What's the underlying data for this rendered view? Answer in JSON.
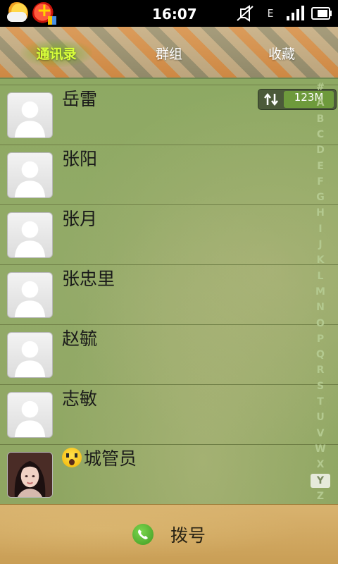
{
  "status_bar": {
    "time": "16:07",
    "network_type": "E",
    "icons": [
      "weather-icon",
      "app-notification-icon",
      "mute-icon",
      "network-type-icon",
      "signal-icon",
      "battery-icon"
    ]
  },
  "tabs": [
    {
      "label": "通讯录",
      "active": true
    },
    {
      "label": "群组",
      "active": false
    },
    {
      "label": "收藏",
      "active": false
    }
  ],
  "memory_badge": {
    "value": "123M",
    "icon": "swap-arrows-icon"
  },
  "contacts": [
    {
      "name": "岳雷",
      "avatar": "default-avatar"
    },
    {
      "name": "张阳",
      "avatar": "default-avatar"
    },
    {
      "name": "张月",
      "avatar": "default-avatar"
    },
    {
      "name": "张忠里",
      "avatar": "default-avatar"
    },
    {
      "name": "赵毓",
      "avatar": "default-avatar"
    },
    {
      "name": "志敏",
      "avatar": "default-avatar"
    },
    {
      "name": "城管员",
      "avatar": "photo-avatar",
      "prefix_emoji": "scream-emoji"
    }
  ],
  "alpha_index": {
    "letters": [
      "#",
      "A",
      "B",
      "C",
      "D",
      "E",
      "F",
      "G",
      "H",
      "I",
      "J",
      "K",
      "L",
      "M",
      "N",
      "O",
      "P",
      "Q",
      "R",
      "S",
      "T",
      "U",
      "V",
      "W",
      "X",
      "Y",
      "Z"
    ],
    "active": "Y"
  },
  "dial_bar": {
    "label": "拨号",
    "icon": "phone-icon"
  },
  "colors": {
    "active_tab": "#d8ff3a",
    "list_background": "#8fa864",
    "dial_bar": "#d4ac66",
    "memory_fill": "#6e9a3c"
  }
}
